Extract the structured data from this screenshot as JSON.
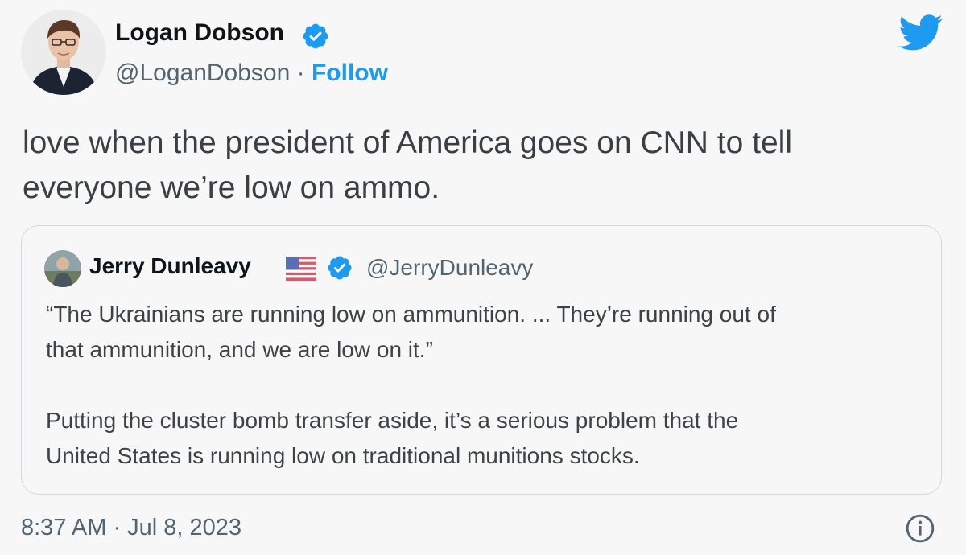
{
  "author": {
    "name": "Logan Dobson",
    "handle": "@LoganDobson",
    "separator": "·",
    "follow_label": "Follow"
  },
  "tweet": {
    "text_line1": "love when the president of America goes on CNN to tell",
    "text_line2": "everyone we’re low on ammo."
  },
  "quote": {
    "name": "Jerry Dunleavy",
    "handle": "@JerryDunleavy",
    "para1_line1": "“The Ukrainians are running low on ammunition. ... They’re running out of",
    "para1_line2": "that ammunition, and we are low on it.”",
    "para2_line1": "Putting the cluster bomb transfer aside, it’s a serious problem that the",
    "para2_line2": "United States is running low on traditional munitions stocks."
  },
  "timestamp": "8:37 AM · Jul 8, 2023",
  "icons": {
    "verified": "verified-badge-icon",
    "brand": "twitter-bird-icon",
    "info": "info-icon",
    "flag": "us-flag-icon"
  },
  "colors": {
    "accent": "#1d9bf0",
    "text": "#0f1419",
    "secondary": "#536471",
    "background": "#f7f7f7",
    "border": "#cfd9de"
  }
}
